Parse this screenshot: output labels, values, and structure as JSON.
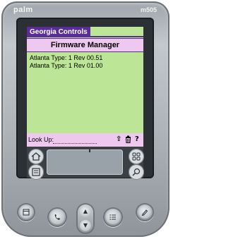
{
  "device": {
    "brand": "palm",
    "model": "m505"
  },
  "app": {
    "title_tab": "Georgia Controls",
    "header": "Firmware Manager"
  },
  "list": {
    "items": [
      "Atlanta Type: 1 Rev 00.51",
      "Atlanta Type: 1 Rev 01.00"
    ]
  },
  "footer": {
    "lookup_label": "Look Up:",
    "lookup_value": "",
    "icons": [
      "arrow-up-icon",
      "trash-icon",
      "help-icon"
    ],
    "icon_glyphs": [
      "⇧",
      "🗑",
      "?"
    ]
  },
  "hardware_buttons": [
    "date-book-button",
    "address-button",
    "scroll-up-button",
    "scroll-down-button",
    "todo-button",
    "memo-button"
  ],
  "colors": {
    "screen": "#bde596",
    "title_bar": "#5a2d9a",
    "header_bg": "#eec8ee"
  }
}
